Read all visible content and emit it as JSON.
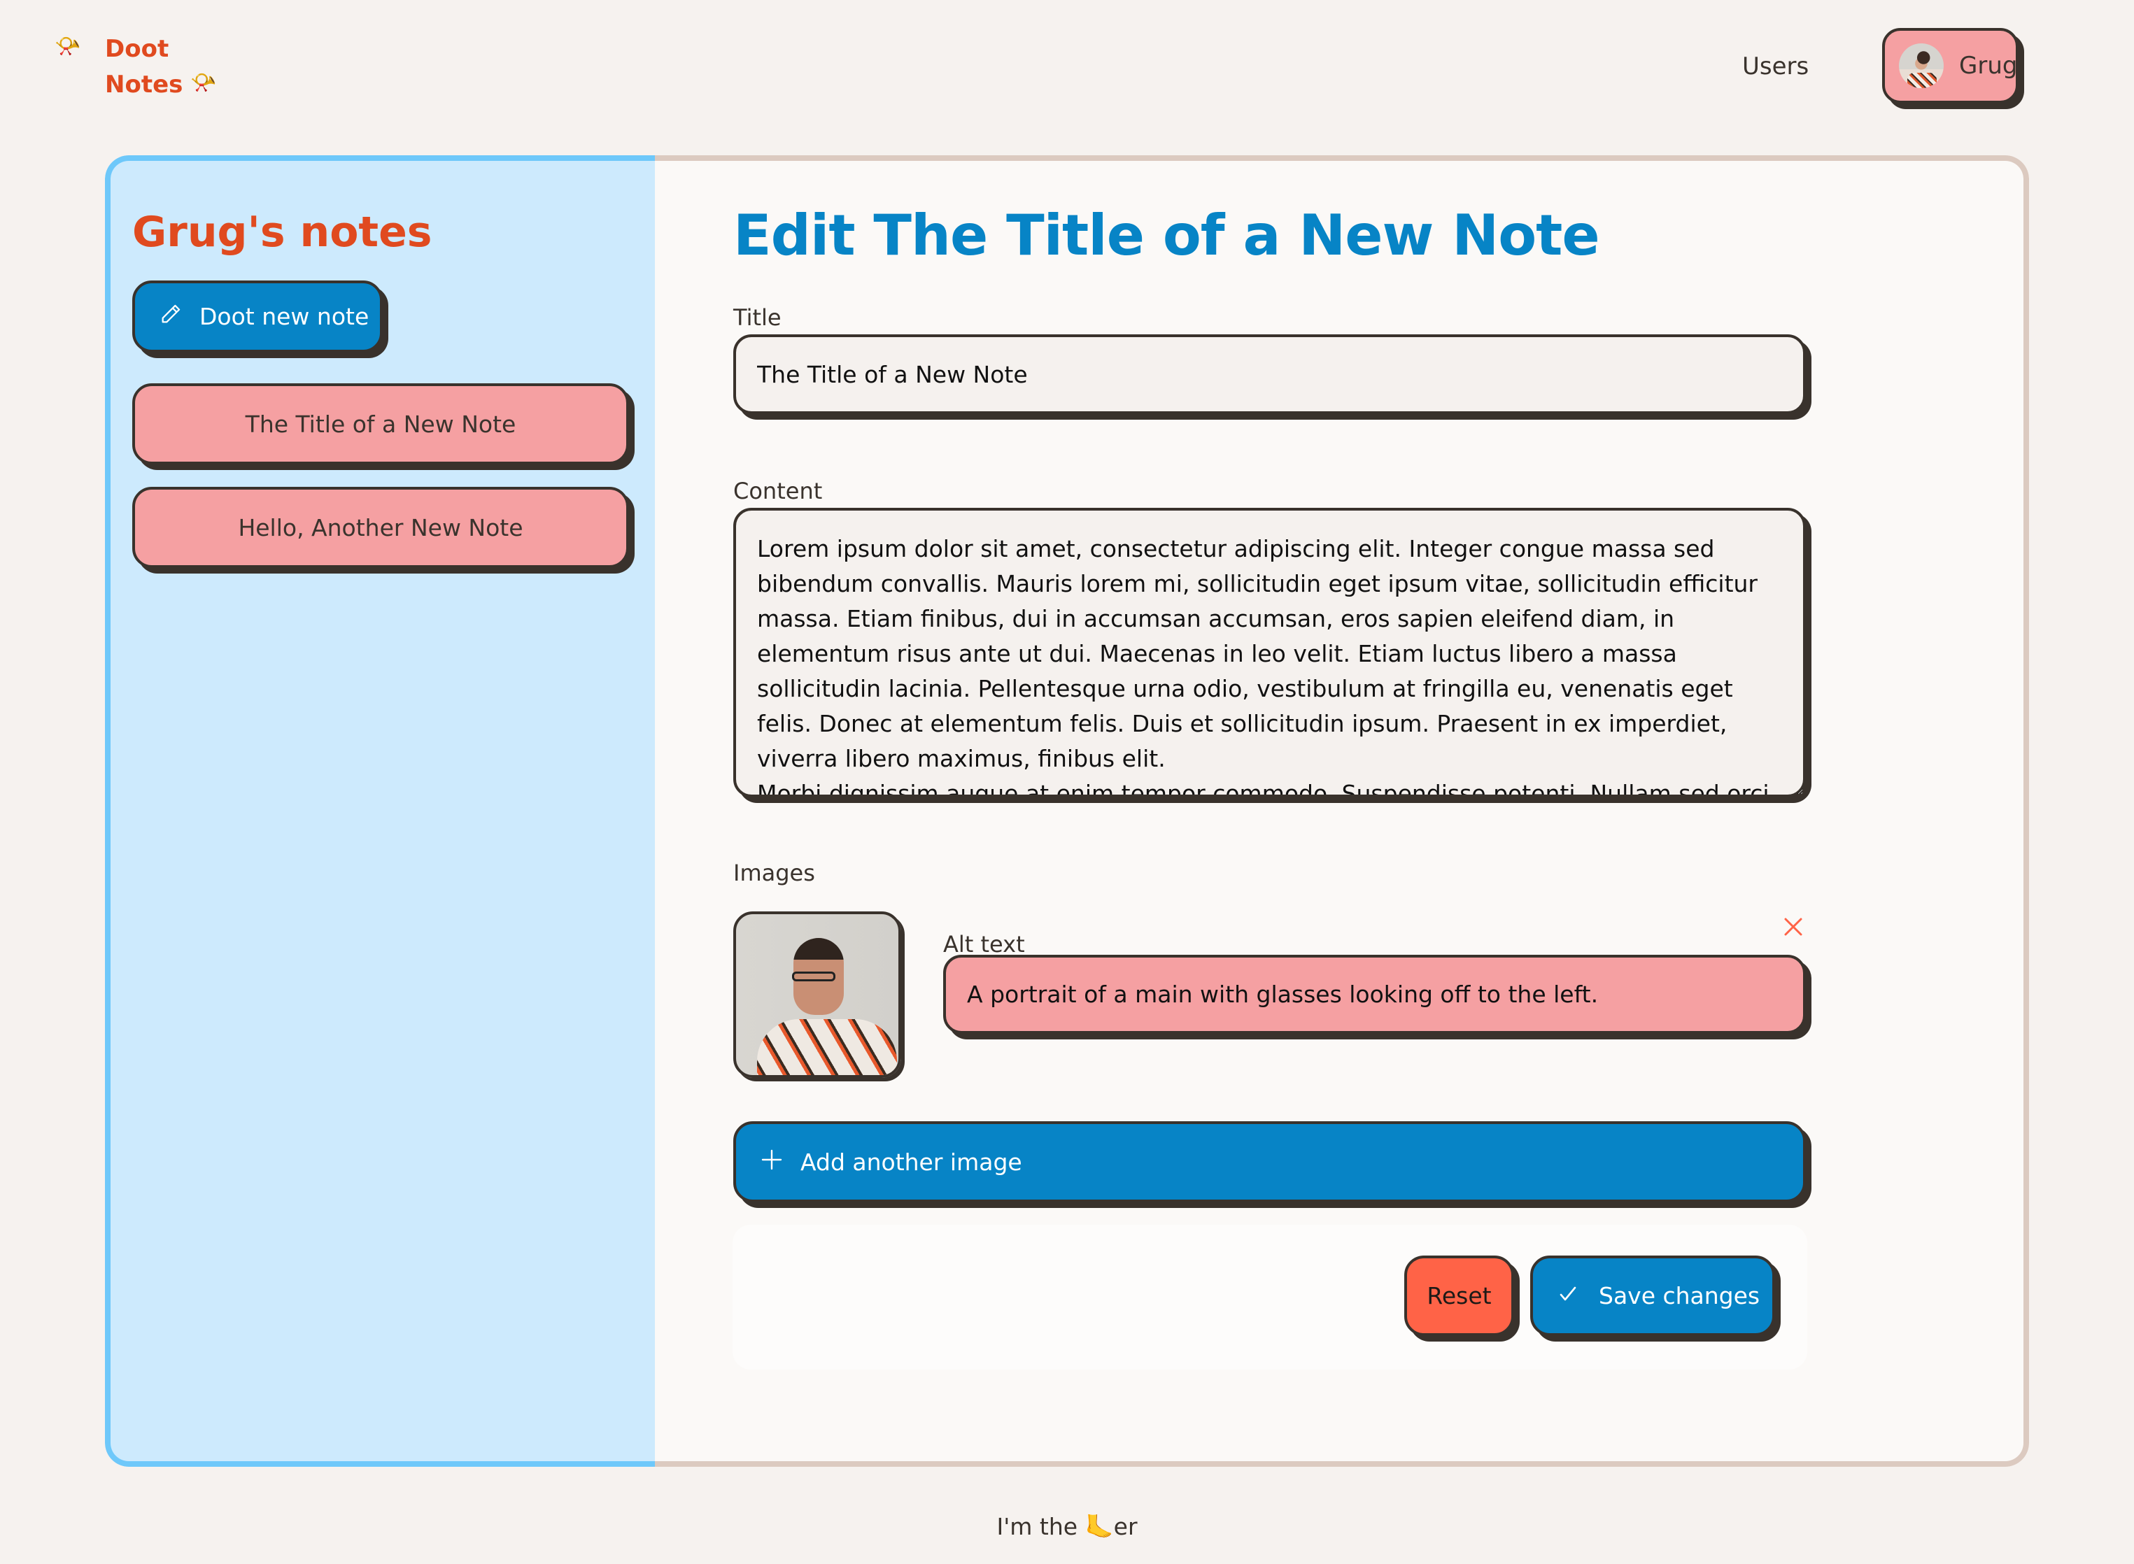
{
  "header": {
    "logo": {
      "line1": "Doot",
      "line2": "Notes",
      "horn_glyph": "📯",
      "horn_icon": "postal-horn-icon",
      "color": "#e04a1f"
    },
    "nav": {
      "users_label": "Users"
    },
    "user": {
      "name": "Grug",
      "avatar_icon": "user-avatar"
    }
  },
  "sidebar": {
    "title": "Grug's notes",
    "new_note_label": "Doot new note",
    "new_note_icon": "pencil-icon",
    "notes": [
      {
        "label": "The Title of a New Note"
      },
      {
        "label": "Hello, Another New Note"
      }
    ]
  },
  "editor": {
    "heading": "Edit The Title of a New Note",
    "title_label": "Title",
    "title_value": "The Title of a New Note",
    "content_label": "Content",
    "content_value": "Lorem ipsum dolor sit amet, consectetur adipiscing elit. Integer congue massa sed bibendum convallis. Mauris lorem mi, sollicitudin eget ipsum vitae, sollicitudin efficitur massa. Etiam finibus, dui in accumsan accumsan, eros sapien eleifend diam, in elementum risus ante ut dui. Maecenas in leo velit. Etiam luctus libero a massa sollicitudin lacinia. Pellentesque urna odio, vestibulum at fringilla eu, venenatis eget felis. Donec at elementum felis. Duis et sollicitudin ipsum. Praesent in ex imperdiet, viverra libero maximus, finibus elit.\nMorbi dignissim augue at enim tempor commodo. Suspendisse potenti. Nullam sed orci",
    "images_label": "Images",
    "images": [
      {
        "alt_label": "Alt text",
        "alt_value": "A portrait of a main with glasses looking off to the left.",
        "remove_icon": "close-icon"
      }
    ],
    "add_image_label": "Add another image",
    "add_image_icon": "plus-icon",
    "reset_label": "Reset",
    "save_label": "Save changes",
    "save_icon": "check-icon"
  },
  "footer": {
    "text_before": "I'm the ",
    "glyph": "🦶",
    "text_after": "er"
  },
  "colors": {
    "accent_blue": "#0784c6",
    "accent_orange": "#e04a1f",
    "pink": "#f5a0a2",
    "reset_red": "#ff6347",
    "sidebar_bg": "#cdeafd",
    "sidebar_border": "#6ec8fa",
    "page_bg": "#f6f2ef"
  }
}
